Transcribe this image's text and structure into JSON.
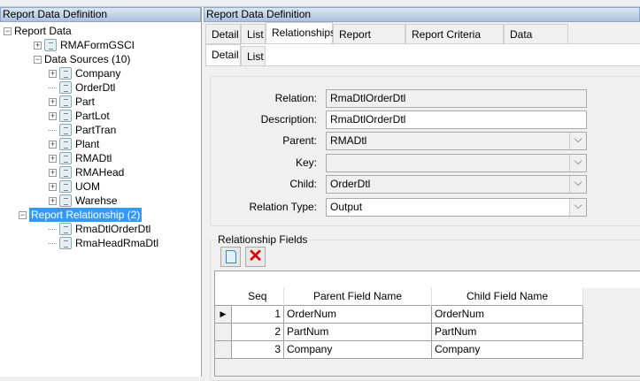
{
  "left_panel": {
    "title": "Report Data Definition",
    "tree": {
      "root": "Report Data",
      "form": "RMAFormGSCI",
      "data_sources": "Data Sources (10)",
      "sources": [
        {
          "label": "Company",
          "expandable": true
        },
        {
          "label": "OrderDtl",
          "expandable": false
        },
        {
          "label": "Part",
          "expandable": true
        },
        {
          "label": "PartLot",
          "expandable": true
        },
        {
          "label": "PartTran",
          "expandable": false
        },
        {
          "label": "Plant",
          "expandable": true
        },
        {
          "label": "RMADtl",
          "expandable": true
        },
        {
          "label": "RMAHead",
          "expandable": true
        },
        {
          "label": "UOM",
          "expandable": true
        },
        {
          "label": "Warehse",
          "expandable": true
        }
      ],
      "relationships": "Report Relationship (2)",
      "relationship_items": [
        "RmaDtlOrderDtl",
        "RmaHeadRmaDtl"
      ]
    }
  },
  "right_panel": {
    "title": "Report Data Definition",
    "tabs": [
      "Detail",
      "List",
      "Relationships",
      "Report Labels",
      "Report Criteria Sets",
      "Data Sources"
    ],
    "active_tab": "Relationships",
    "subtabs": [
      "Detail",
      "List"
    ],
    "active_subtab": "Detail",
    "form": {
      "relation_label": "Relation:",
      "relation": "RmaDtlOrderDtl",
      "description_label": "Description:",
      "description": "RmaDtlOrderDtl",
      "parent_label": "Parent:",
      "parent": "RMADtl",
      "key_label": "Key:",
      "key": "",
      "child_label": "Child:",
      "child": "OrderDtl",
      "relation_type_label": "Relation Type:",
      "relation_type": "Output"
    },
    "fields_group": {
      "title": "Relationship Fields",
      "columns": [
        "Seq",
        "Parent Field Name",
        "Child Field Name"
      ],
      "rows": [
        {
          "seq": "1",
          "parent": "OrderNum",
          "child": "OrderNum"
        },
        {
          "seq": "2",
          "parent": "PartNum",
          "child": "PartNum"
        },
        {
          "seq": "3",
          "parent": "Company",
          "child": "Company"
        }
      ]
    }
  },
  "colors": {
    "selection": "#3399ff",
    "delete": "#e00000"
  }
}
